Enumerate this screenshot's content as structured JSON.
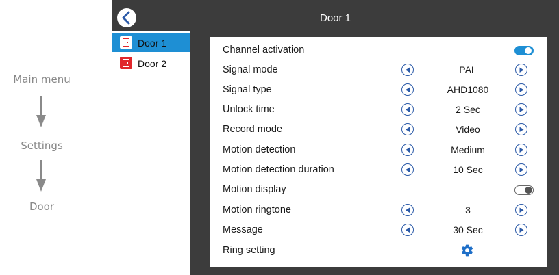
{
  "flow": {
    "steps": [
      "Main menu",
      "Settings",
      "Door"
    ]
  },
  "header": {
    "title": "Door 1",
    "back_icon": "back-chevron-icon"
  },
  "sidebar": {
    "items": [
      {
        "label": "Door 1",
        "icon": "door-icon",
        "active": true
      },
      {
        "label": "Door 2",
        "icon": "door-icon",
        "active": false
      }
    ]
  },
  "settings": {
    "channel_activation": {
      "label": "Channel activation",
      "toggle": "on"
    },
    "signal_mode": {
      "label": "Signal mode",
      "value": "PAL"
    },
    "signal_type": {
      "label": "Signal type",
      "value": "AHD1080"
    },
    "unlock_time": {
      "label": "Unlock time",
      "value": "2 Sec"
    },
    "record_mode": {
      "label": "Record mode",
      "value": "Video"
    },
    "motion_detection": {
      "label": "Motion detection",
      "value": "Medium"
    },
    "motion_detection_duration": {
      "label": "Motion detection duration",
      "value": "10 Sec"
    },
    "motion_display": {
      "label": "Motion display",
      "toggle": "off"
    },
    "motion_ringtone": {
      "label": "Motion ringtone",
      "value": "3"
    },
    "message": {
      "label": "Message",
      "value": "30 Sec"
    },
    "ring_setting": {
      "label": "Ring setting",
      "icon": "gear-icon"
    }
  },
  "colors": {
    "accent": "#1e8fd4",
    "screen_bg": "#3c3c3c",
    "door_icon": "#e0262b",
    "arrow_button": "#2b5aa8"
  }
}
